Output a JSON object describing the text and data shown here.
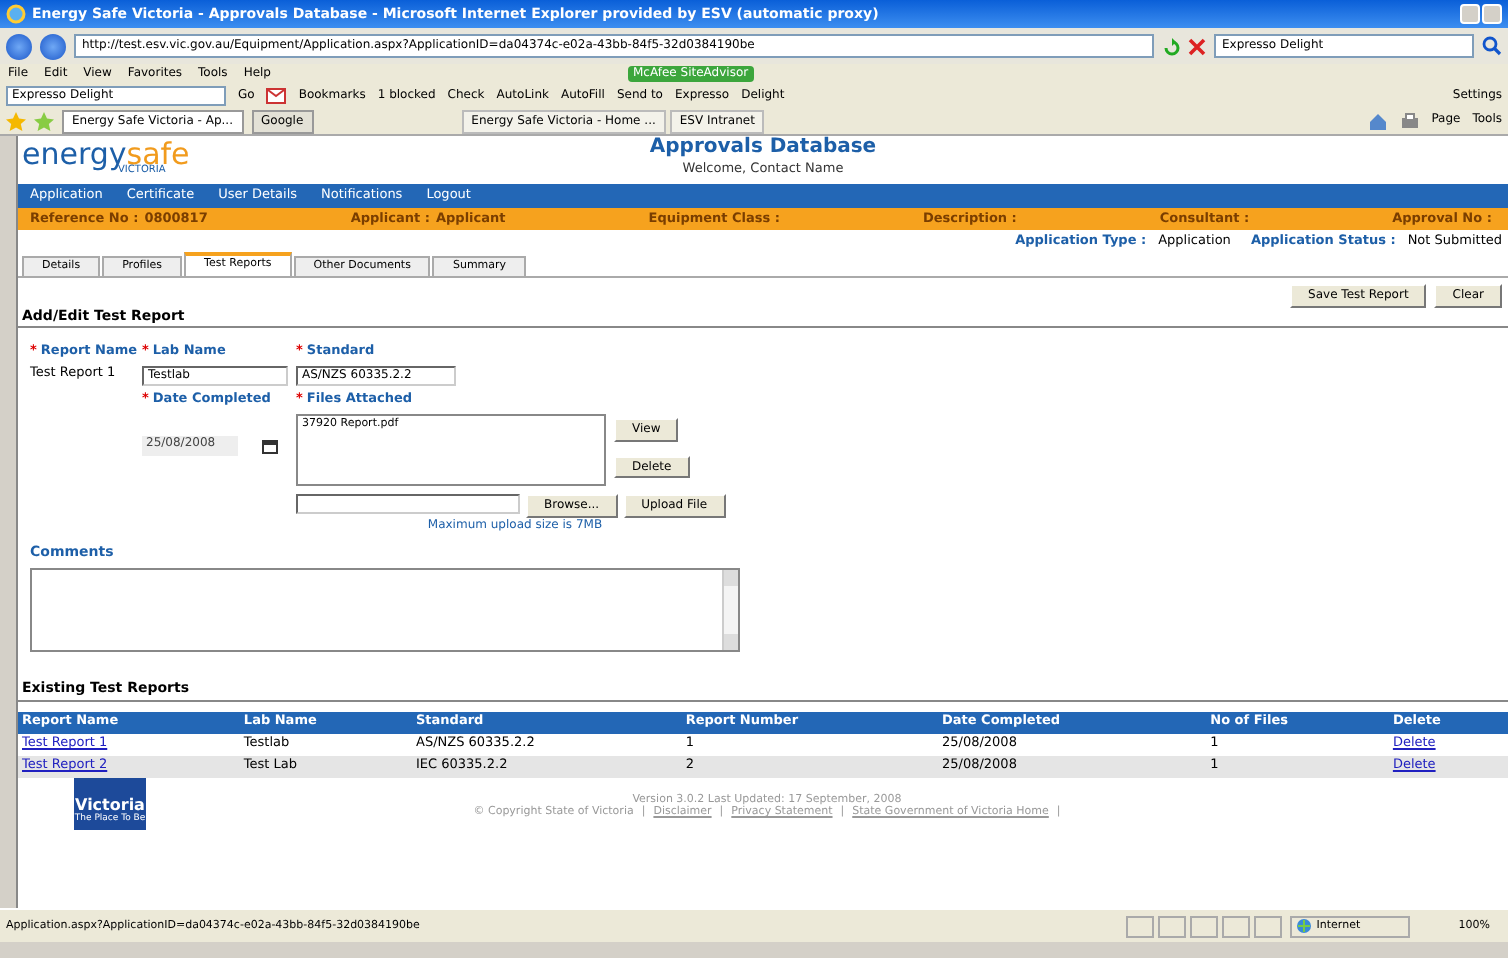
{
  "browser": {
    "title": "Energy Safe Victoria - Approvals Database - Microsoft Internet Explorer provided by ESV (automatic proxy)",
    "address": "http://test.esv.vic.gov.au/Equipment/Application.aspx?ApplicationID=da04374c-e02a-43bb-84f5-32d0384190be",
    "search": "Expresso Delight",
    "menu": [
      "File",
      "Edit",
      "View",
      "Favorites",
      "Tools",
      "Help"
    ],
    "addon": "McAfee SiteAdvisor",
    "toolbar": {
      "search": "Expresso Delight",
      "go": "Go",
      "items": [
        "Bookmarks",
        "1 blocked",
        "Check",
        "AutoLink",
        "AutoFill",
        "Send to",
        "Expresso",
        "Delight"
      ],
      "settings": "Settings"
    },
    "tabs": [
      {
        "label": "Energy Safe Victoria - Ap...",
        "selected": true
      },
      {
        "label": "Google",
        "selected": false
      }
    ],
    "favorites": [
      "Energy Safe Victoria - Home ...",
      "ESV Intranet"
    ],
    "commands": [
      "Page",
      "Tools"
    ]
  },
  "header": {
    "logo": {
      "word1": "energy",
      "word2": "safe",
      "sub": "VICTORIA"
    },
    "title": "Approvals Database",
    "welcome": "Welcome, Contact Name"
  },
  "nav": [
    "Application",
    "Certificate",
    "User Details",
    "Notifications",
    "Logout"
  ],
  "summary": [
    {
      "label": "Reference No :",
      "value": "0800817"
    },
    {
      "label": "Applicant :",
      "value": "Applicant"
    },
    {
      "label": "Equipment Class :"
    },
    {
      "label": "Description :"
    },
    {
      "label": "Consultant :"
    },
    {
      "label": "Approval No :"
    }
  ],
  "status": [
    {
      "label": "Application Type :",
      "value": "Application"
    },
    {
      "label": "Application Status :",
      "value": "Not Submitted"
    }
  ],
  "tabs": [
    {
      "label": "Details",
      "selected": false
    },
    {
      "label": "Profiles",
      "selected": false
    },
    {
      "label": "Test Reports",
      "selected": true
    },
    {
      "label": "Other Documents",
      "selected": false
    },
    {
      "label": "Summary",
      "selected": false
    }
  ],
  "actions": [
    "Save Test Report",
    "Clear"
  ],
  "form": {
    "heading": "Add/Edit Test Report",
    "report_name": {
      "mark": "*",
      "label": "Report Name",
      "value": "Test Report 1"
    },
    "lab_name": {
      "mark": "*",
      "label": "Lab Name",
      "value": "Testlab"
    },
    "standard": {
      "mark": "*",
      "label": "Standard",
      "value": "AS/NZS 60335.2.2"
    },
    "date_completed": {
      "mark": "*",
      "label": "Date Completed",
      "value": "25/08/2008",
      "disabled": true
    },
    "files_attached": {
      "mark": "*",
      "label": "Files Attached",
      "files": [
        "37920 Report.pdf"
      ]
    },
    "file_buttons": [
      "View",
      "Delete"
    ],
    "browse": "Browse...",
    "upload": "Upload File",
    "note": "Maximum upload size is 7MB",
    "comments": {
      "label": "Comments"
    }
  },
  "table": {
    "title": "Existing Test Reports",
    "columns": [
      "Report Name",
      "Lab Name",
      "Standard",
      "Report Number",
      "Date Completed",
      "No of Files",
      "Delete"
    ],
    "rows": [
      [
        "Test Report 1",
        "Testlab",
        "AS/NZS 60335.2.2",
        "1",
        "25/08/2008",
        "1",
        "Delete"
      ],
      [
        "Test Report 2",
        "Test Lab",
        "IEC 60335.2.2",
        "2",
        "25/08/2008",
        "1",
        "Delete"
      ]
    ]
  },
  "footer": {
    "logo": {
      "name": "Victoria",
      "tagline": "The Place To Be"
    },
    "version": "Version 3.0.2  Last Updated: 17 September, 2008",
    "links": [
      {
        "text": "© Copyright State of Victoria",
        "kind": "text"
      },
      {
        "text": "|",
        "kind": "sep"
      },
      {
        "text": "Disclaimer",
        "kind": "link"
      },
      {
        "text": "|",
        "kind": "sep"
      },
      {
        "text": "Privacy Statement",
        "kind": "link"
      },
      {
        "text": "|",
        "kind": "sep"
      },
      {
        "text": "State Government of Victoria Home",
        "kind": "link"
      },
      {
        "text": "|",
        "kind": "sep"
      }
    ]
  },
  "status_bar": {
    "text": "Application.aspx?ApplicationID=da04374c-e02a-43bb-84f5-32d0384190be",
    "zone": "Internet",
    "zoom": "100%"
  }
}
